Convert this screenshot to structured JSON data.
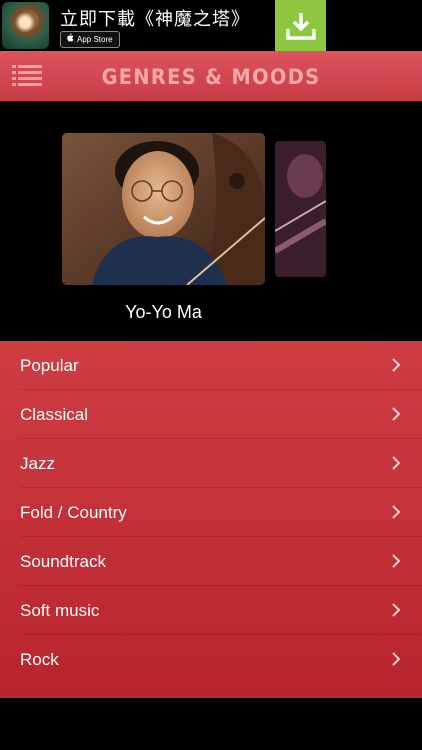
{
  "ad": {
    "title": "立即下載《神魔之塔》",
    "store_badge": "App Store",
    "accent": "#8dc63f"
  },
  "header": {
    "title": "GENRES & MOODS",
    "color": "#d44a52"
  },
  "carousel": {
    "featured_artist": "Yo-Yo Ma"
  },
  "genres": [
    {
      "label": "Popular"
    },
    {
      "label": "Classical"
    },
    {
      "label": "Jazz"
    },
    {
      "label": "Fold / Country"
    },
    {
      "label": "Soundtrack"
    },
    {
      "label": "Soft music"
    },
    {
      "label": "Rock"
    }
  ],
  "icons": {
    "menu": "list-menu-icon",
    "download": "download-icon",
    "apple": "apple-icon",
    "chevron": "chevron-right-icon"
  }
}
